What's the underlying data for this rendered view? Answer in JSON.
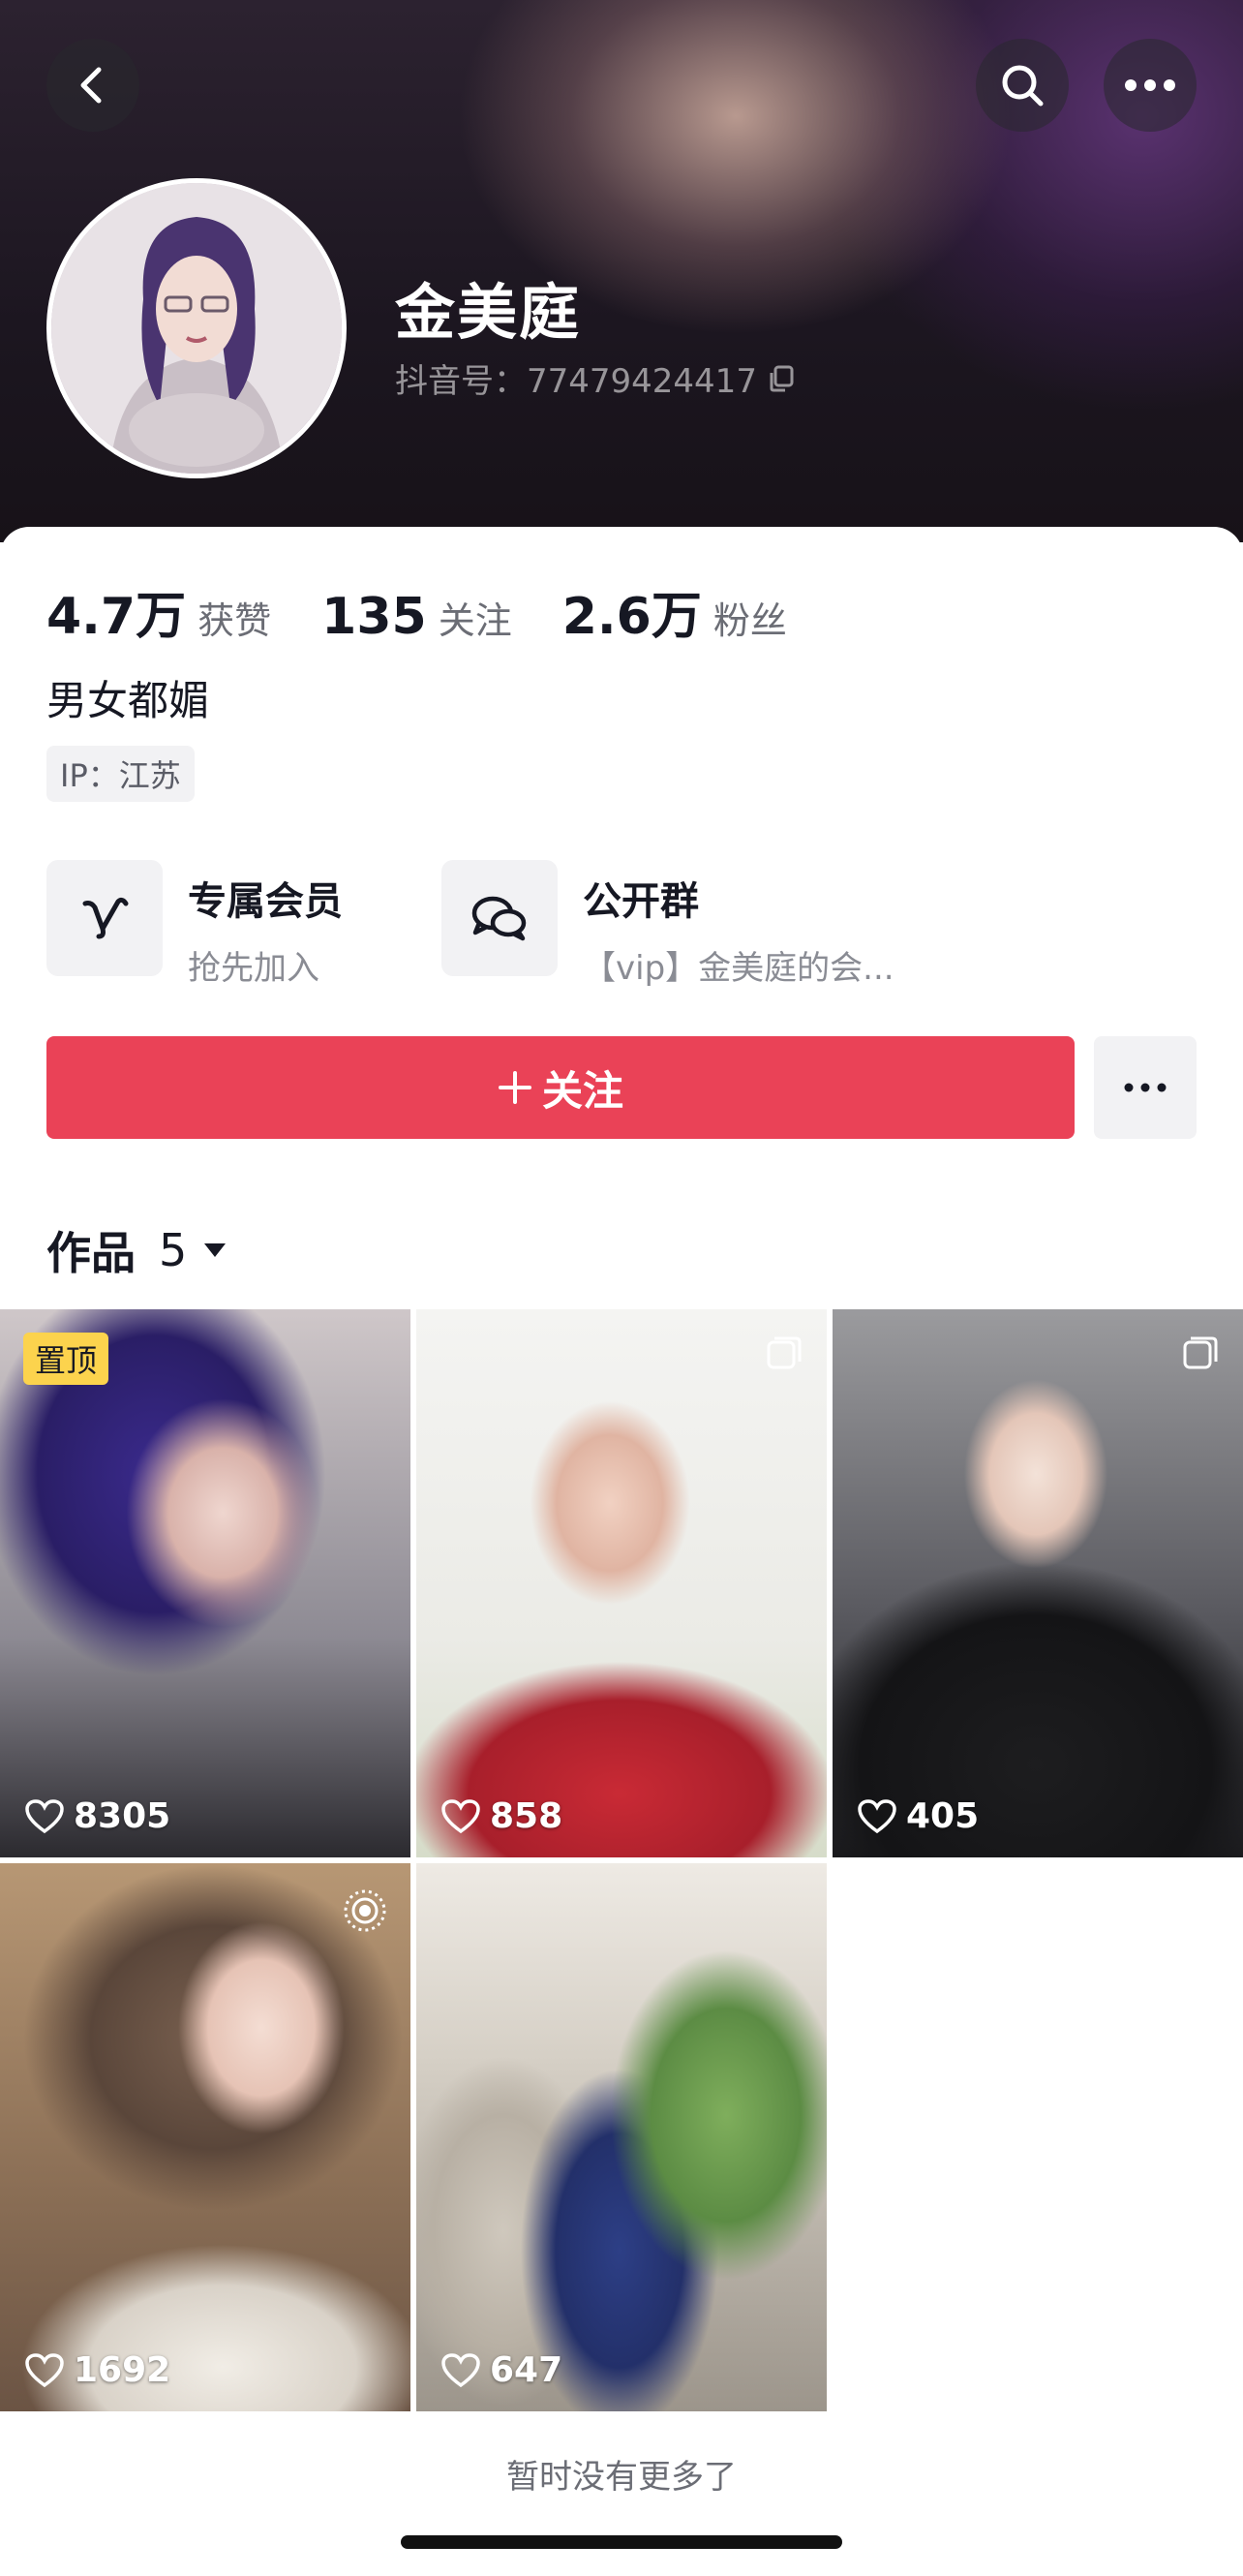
{
  "profile": {
    "nickname": "金美庭",
    "douyin_id": "抖音号：77479424417",
    "bio": "男女都媚",
    "ip": "IP：江苏"
  },
  "stats": [
    {
      "value": "4.7万",
      "label": "获赞"
    },
    {
      "value": "135",
      "label": "关注"
    },
    {
      "value": "2.6万",
      "label": "粉丝"
    }
  ],
  "features": [
    {
      "title": "专属会员",
      "subtitle": "抢先加入",
      "icon": "vip-v-icon"
    },
    {
      "title": "公开群",
      "subtitle": "【vip】金美庭的会...",
      "icon": "chat-group-icon"
    }
  ],
  "actions": {
    "follow_label": "关注",
    "more_icon": "more-dots-icon"
  },
  "works": {
    "label": "作品",
    "count": "5",
    "items": [
      {
        "likes": "8305",
        "badge": "置顶",
        "multi": false,
        "live": false
      },
      {
        "likes": "858",
        "badge": "",
        "multi": true,
        "live": false
      },
      {
        "likes": "405",
        "badge": "",
        "multi": true,
        "live": false
      },
      {
        "likes": "1692",
        "badge": "",
        "multi": false,
        "live": true
      },
      {
        "likes": "647",
        "badge": "",
        "multi": false,
        "live": false
      }
    ]
  },
  "footer": {
    "end_text": "暂时没有更多了"
  },
  "colors": {
    "follow": "#ea4257",
    "pin_badge": "#fcd34d"
  }
}
